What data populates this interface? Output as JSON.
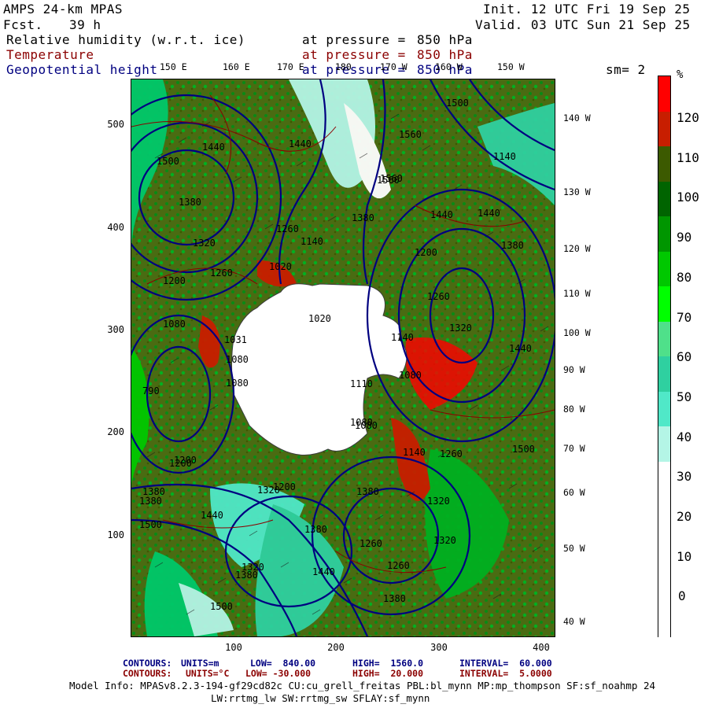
{
  "header": {
    "model": "AMPS 24-km MPAS",
    "fcst_label": "Fcst.",
    "fcst_value": "39 h",
    "init": "Init. 12 UTC Fri 19 Sep 25",
    "valid": "Valid. 03 UTC Sun 21 Sep 25",
    "field1": "Relative humidity (w.r.t. ice)",
    "field2": "Temperature",
    "field3": "Geopotential height",
    "pressure_label": "at pressure =",
    "pressure_value": "850 hPa",
    "sm": "sm= 2"
  },
  "top_lon_labels": [
    "150 E",
    "160 E",
    "170 E",
    "180",
    "170 W",
    "160 W",
    "150 W"
  ],
  "right_lon_labels": [
    "140 W",
    "130 W",
    "120 W",
    "110 W",
    "100 W",
    "90 W",
    "80 W",
    "70 W",
    "60 W",
    "50 W",
    "40 W"
  ],
  "y_ticks": [
    "500",
    "400",
    "300",
    "200",
    "100"
  ],
  "x_ticks": [
    "100",
    "200",
    "300",
    "400"
  ],
  "colorbar": {
    "unit": "%",
    "labels": [
      "120",
      "110",
      "100",
      "90",
      "80",
      "70",
      "60",
      "50",
      "40",
      "30",
      "20",
      "10",
      "0"
    ],
    "colors": [
      "#ff0000",
      "#c81e00",
      "#3c5a00",
      "#006400",
      "#009600",
      "#00c800",
      "#00ff00",
      "#4fe08a",
      "#2fd0a0",
      "#50e8c8",
      "#b4f5e6",
      "#ffffff",
      "#ffffff",
      "#ffffff",
      "#ffffff",
      "#ffffff"
    ]
  },
  "contour_labels": [
    "1500",
    "1440",
    "1440",
    "1380",
    "1380",
    "1320",
    "1260",
    "1200",
    "1140",
    "1080",
    "1020",
    "1560",
    "1560",
    "1500",
    "1440",
    "1380",
    "1320",
    "1260",
    "1200",
    "1140",
    "1080",
    "1020",
    "1031",
    "1110",
    "1080",
    "1080",
    "1140",
    "1260",
    "1320",
    "1380",
    "1440",
    "1500",
    "1380",
    "1320",
    "1260",
    "1200",
    "1440",
    "1440",
    "1500",
    "1500",
    "1380",
    "1320",
    "1260",
    "1200",
    "1140",
    "1260",
    "1380",
    "1320",
    "1380",
    "1440",
    "1080",
    "790",
    "1080",
    "1200",
    "1560",
    "1380"
  ],
  "footer": {
    "c1_label": "CONTOURS:",
    "c1_units": "UNITS=m",
    "c1_low": "LOW=  840.00",
    "c1_high": "HIGH=  1560.0",
    "c1_interval": "INTERVAL=  60.000",
    "c2_label": "CONTOURS:",
    "c2_units": "UNITS=°C",
    "c2_low": "LOW= -30.000",
    "c2_high": "HIGH=  20.000",
    "c2_interval": "INTERVAL=  5.0000",
    "info1": "Model Info: MPASv8.2.3-194-gf29cd82c CU:cu_grell_freitas PBL:bl_mynn MP:mp_thompson SF:sf_noahmp 24",
    "info2": "LW:rrtmg_lw SW:rrtmg_sw SFLAY:sf_mynn"
  }
}
